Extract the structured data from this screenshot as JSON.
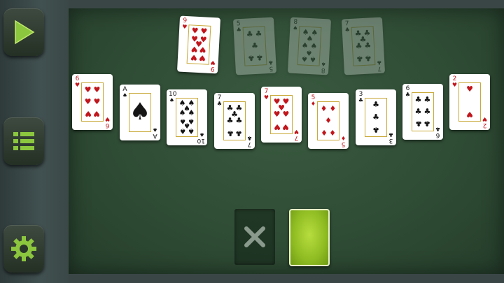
{
  "sidebar": {
    "buttons": [
      {
        "name": "play-button",
        "icon": "play-icon"
      },
      {
        "name": "menu-button",
        "icon": "list-icon"
      },
      {
        "name": "settings-button",
        "icon": "gear-icon"
      }
    ],
    "accent": "#8cc63f"
  },
  "foundation": [
    {
      "rank": "9",
      "suit": "hearts",
      "color": "red",
      "ghost": false
    },
    {
      "rank": "5",
      "suit": "clubs",
      "color": "black",
      "ghost": true
    },
    {
      "rank": "8",
      "suit": "spades",
      "color": "black",
      "ghost": true
    },
    {
      "rank": "7",
      "suit": "clubs",
      "color": "black",
      "ghost": true
    }
  ],
  "tableau": [
    {
      "rank": "6",
      "suit": "hearts",
      "color": "red"
    },
    {
      "rank": "A",
      "suit": "spades",
      "color": "black"
    },
    {
      "rank": "10",
      "suit": "spades",
      "color": "black"
    },
    {
      "rank": "7",
      "suit": "clubs",
      "color": "black"
    },
    {
      "rank": "7",
      "suit": "hearts",
      "color": "red"
    },
    {
      "rank": "5",
      "suit": "diamonds",
      "color": "red"
    },
    {
      "rank": "3",
      "suit": "clubs",
      "color": "black"
    },
    {
      "rank": "6",
      "suit": "clubs",
      "color": "black"
    },
    {
      "rank": "2",
      "suit": "hearts",
      "color": "red"
    }
  ],
  "discard": {
    "icon": "close-icon",
    "empty": true
  },
  "stock": {
    "icon": "card-back",
    "color": "#9ac42a"
  },
  "suit_symbols": {
    "hearts": "♥",
    "diamonds": "♦",
    "clubs": "♣",
    "spades": "♠"
  }
}
